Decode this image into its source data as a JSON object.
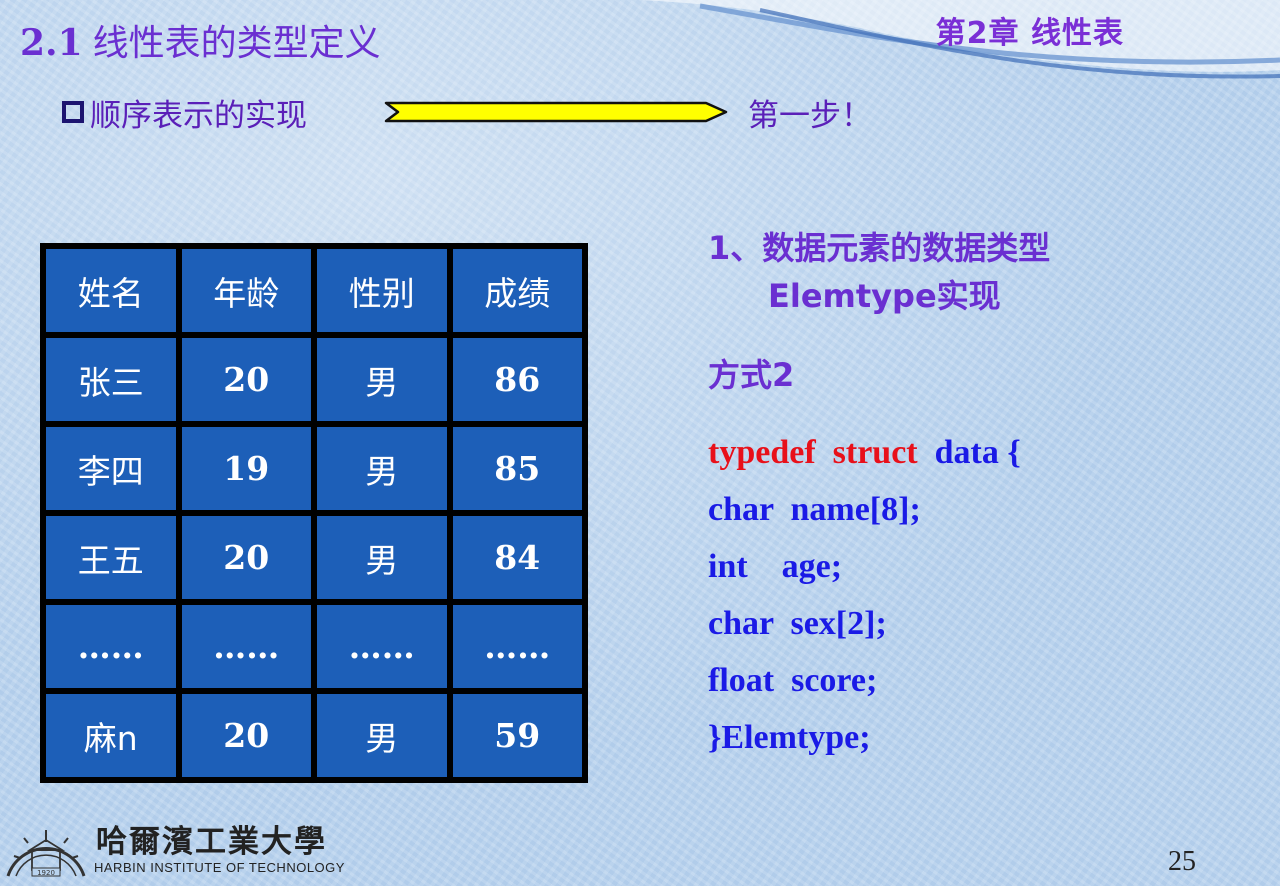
{
  "header": {
    "section_number": "2.1",
    "section_title": "线性表的类型定义",
    "chapter": "第2章  线性表"
  },
  "bullet": {
    "text": "顺序表示的实现",
    "step": "第一步！"
  },
  "table": {
    "headers": [
      "姓名",
      "年龄",
      "性别",
      "成绩"
    ],
    "rows": [
      [
        "张三",
        "20",
        "男",
        "86"
      ],
      [
        "李四",
        "19",
        "男",
        "85"
      ],
      [
        "王五",
        "20",
        "男",
        "84"
      ],
      [
        "……",
        "……",
        "……",
        "……"
      ],
      [
        "麻n",
        "20",
        "男",
        "59"
      ]
    ]
  },
  "content": {
    "heading_line1": "1、数据元素的数据类型",
    "heading_line2": "Elemtype实现",
    "mode": "方式2",
    "code": {
      "line1_kw1": "typedef",
      "line1_kw2": "struct",
      "line1_rest": "data {",
      "line2": "char  name[8];",
      "line3": "int    age;",
      "line4": "char  sex[2];",
      "line5": "float  score;",
      "line6": "}Elemtype;"
    }
  },
  "footer": {
    "university_cn": "哈爾濱工業大學",
    "university_en": "HARBIN INSTITUTE OF TECHNOLOGY",
    "logo_year": "1920",
    "page_number": "25"
  },
  "colors": {
    "title_purple": "#6a2fd1",
    "table_cell": "#1d5fb8",
    "code_blue": "#1a1ae6",
    "keyword_red": "#e8101a",
    "arrow_yellow": "#ffff00"
  }
}
